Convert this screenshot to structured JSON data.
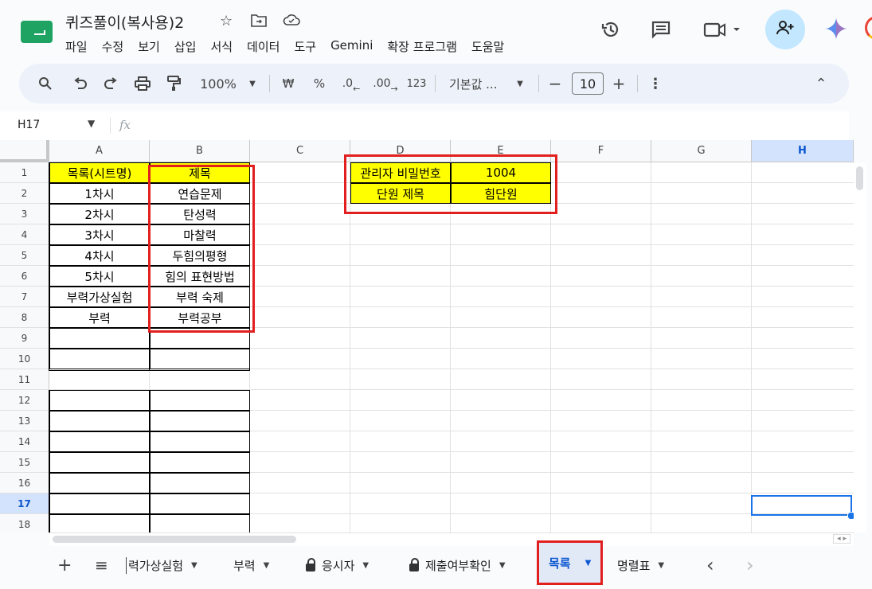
{
  "window": {
    "doc_title": "퀴즈풀이(복사용)2",
    "menu": [
      "파일",
      "수정",
      "보기",
      "삽입",
      "서식",
      "데이터",
      "도구",
      "Gemini",
      "확장 프로그램",
      "도움말"
    ]
  },
  "icons": {
    "star": "star-icon",
    "move": "move-to-folder-icon",
    "cloud": "cloud-status-icon",
    "history": "version-history-icon",
    "comments": "comments-icon",
    "meet": "video-call-icon",
    "share": "add-person-icon",
    "gemini": "gemini-spark-icon"
  },
  "toolbar": {
    "zoom": "100%",
    "currency": "₩",
    "percent": "%",
    "dec_decrease": ".0",
    "dec_increase": ".00",
    "number_format": "123",
    "font": "기본값 ...",
    "minus": "−",
    "font_size": "10",
    "plus": "+",
    "more": "⋮",
    "collapse": "⌃"
  },
  "formula_bar": {
    "name_box": "H17",
    "fx": "fx",
    "formula": ""
  },
  "grid": {
    "columns": [
      "A",
      "B",
      "C",
      "D",
      "E",
      "F",
      "G",
      "H"
    ],
    "active_column": "H",
    "rows": [
      "1",
      "2",
      "3",
      "4",
      "5",
      "6",
      "7",
      "8",
      "9",
      "10",
      "11",
      "12",
      "13",
      "14",
      "15",
      "16",
      "17",
      "18"
    ],
    "active_row": "17",
    "selected_cell": "H17",
    "cells": {
      "A1": "목록(시트명)",
      "B1": "제목",
      "A2": "1차시",
      "B2": "연습문제",
      "A3": "2차시",
      "B3": "탄성력",
      "A4": "3차시",
      "B4": "마찰력",
      "A5": "4차시",
      "B5": "두힘의평형",
      "A6": "5차시",
      "B6": "힘의 표현방법",
      "A7": "부력가상실험",
      "B7": "부력 숙제",
      "A8": "부력",
      "B8": "부력공부",
      "D1": "관리자 비밀번호",
      "E1": "1004",
      "D2": "단원 제목",
      "E2": "힘단원"
    },
    "highlight_color": "#ffff00",
    "annotation_color": "#e21f1f"
  },
  "sheet_tabs": {
    "add": "+",
    "all_sheets": "≡",
    "tabs": [
      {
        "label": "부력가상실험",
        "visible": "력가상실험",
        "locked": false
      },
      {
        "label": "부력",
        "locked": false
      },
      {
        "label": "응시자",
        "locked": true
      },
      {
        "label": "제출여부확인",
        "locked": true
      },
      {
        "label": "목록",
        "locked": false,
        "active": true
      },
      {
        "label": "명렬표",
        "locked": false
      }
    ],
    "prev": "‹",
    "next": "›"
  }
}
